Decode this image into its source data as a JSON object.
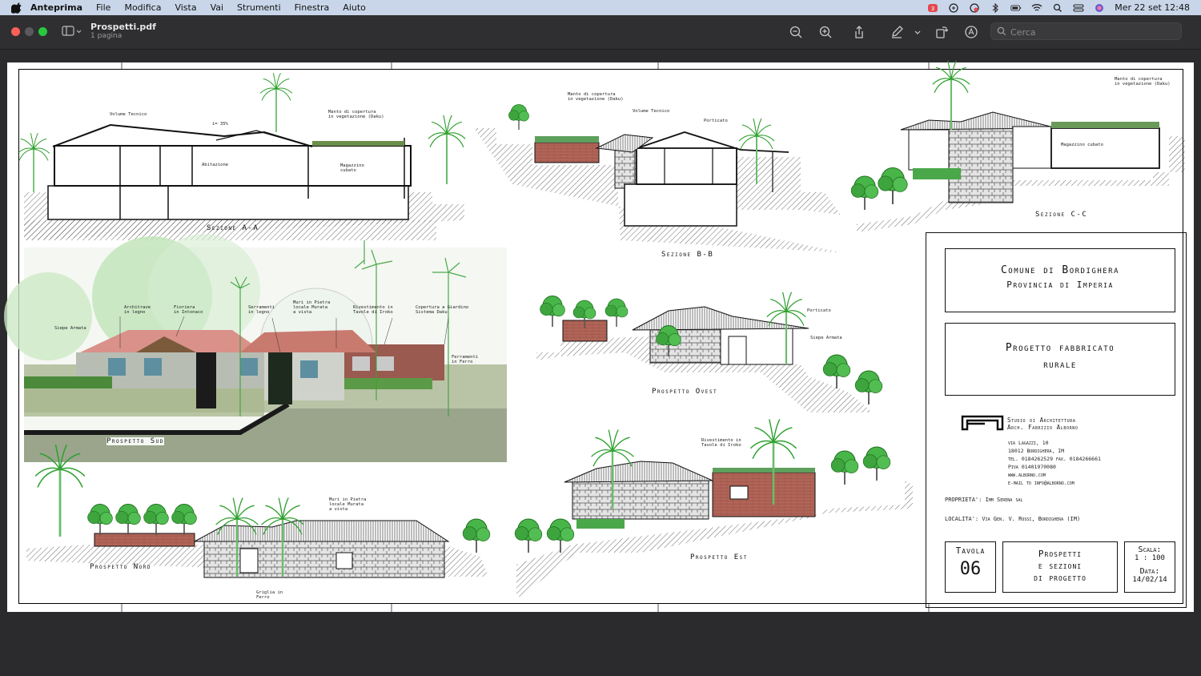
{
  "menubar": {
    "app_name": "Anteprima",
    "items": [
      "File",
      "Modifica",
      "Vista",
      "Vai",
      "Strumenti",
      "Finestra",
      "Aiuto"
    ],
    "clock": "Mer 22 set  12:48"
  },
  "window": {
    "title": "Prospetti.pdf",
    "subtitle": "1 pagina",
    "search_placeholder": "Cerca"
  },
  "drawing": {
    "labels": {
      "section_aa": "Sezione A-A",
      "section_bb": "Sezione B-B",
      "section_cc": "Sezione C-C",
      "elev_sud": "Prospetto Sud",
      "elev_ovest": "Prospetto Ovest",
      "elev_nord": "Prospetto Nord",
      "elev_est": "Prospetto Est"
    },
    "notes": {
      "aa_volume": "Volume Tecnico",
      "aa_slope": "i= 35%",
      "aa_manto": "Manto di copertura\nin vegetazione (Daku)",
      "aa_abitazione": "Abitazione",
      "aa_magazzino": "Magazzino\ncubato",
      "bb_manto": "Manto di copertura\nin vegetazione (Daku)",
      "bb_volume": "Volume Tecnico",
      "bb_porticato": "Porticato",
      "cc_manto": "Manto di copertura\nin vegetazione (Daku)",
      "cc_magazzino": "Magazzino cubato",
      "sud_architrave": "Architrave\nin legno",
      "sud_fioriera": "Fioriera\nin Intonaco",
      "sud_serramenti": "Serramenti\nin legno",
      "sud_muri": "Muri in Pietra\nlocale Murata\na vista",
      "sud_rivestimento": "Rivestimento in\nTavole di Iroko",
      "sud_copertura": "Copertura a Giardino\nSistema Daku",
      "sud_siepe": "Siepe Armata",
      "sud_ferramenti": "Ferramenti\nin Ferro",
      "ovest_porticato": "Porticato",
      "ovest_siepe": "Siepe Armata",
      "nord_muri": "Muri in Pietra\nlocale Murata\na vista",
      "nord_griglia": "Griglia in\nFerro",
      "est_rivestimento": "Rivestimento in\nTavole di Iroko"
    }
  },
  "title_block": {
    "comune": "Comune di Bordighera",
    "provincia": "Provincia di Imperia",
    "progetto_1": "Progetto fabbricato",
    "progetto_2": "rurale",
    "studio_1": "Studio di Architettura",
    "studio_2": "Arch. Fabrizio Alborno",
    "address": [
      "via Lagazzi, 10",
      "18012 Bordighera, IM",
      "tel. 0184262529  fax. 0184266661",
      "Piva 01401970080",
      "www.alborno.com",
      "e-mail to info@alborno.com"
    ],
    "proprieta": "PROPRIETA': Imm Serena sal",
    "localita": "LOCALITA': Via Gen. V. Rossi, Bordighera (IM)",
    "tavola_label": "Tavola",
    "tavola_num": "06",
    "desc_1": "Prospetti",
    "desc_2": "e sezioni",
    "desc_3": "di progetto",
    "scala_label": "Scala:",
    "scala_value": "1 : 100",
    "data_label": "Data:",
    "data_value": "14/02/14"
  },
  "colors": {
    "menubar_bg": "#c9d6ea",
    "toolbar_bg": "#2f2f31",
    "page_bg": "#ffffff",
    "tree_green": "#3fb03f",
    "roof_red": "#c97a6e",
    "brick": "#b5675a"
  }
}
